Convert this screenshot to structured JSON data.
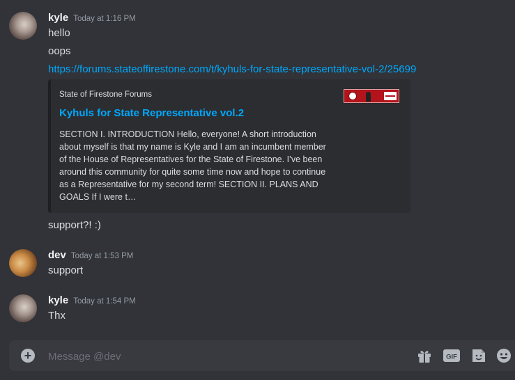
{
  "messages": [
    {
      "username": "kyle",
      "timestamp": "Today at 1:16 PM",
      "lines": [
        "hello",
        "oops",
        "https://forums.stateoffirestone.com/t/kyhuls-for-state-representative-vol-2/25699"
      ],
      "embed": {
        "provider": "State of Firestone Forums",
        "title": "Kyhuls for State Representative vol.2",
        "description": "SECTION I. INTRODUCTION Hello, everyone! A short introduction about myself is that my name is Kyle and I am an incumbent member of the House of Representatives for the State of Firestone. I’ve been around this community for quite some time now and hope to continue as a Representative for my second term! SECTION II. PLANS AND GOALS If I were t…"
      },
      "after_embed": "support?! :)"
    },
    {
      "username": "dev",
      "timestamp": "Today at 1:53 PM",
      "lines": [
        "support"
      ]
    },
    {
      "username": "kyle",
      "timestamp": "Today at 1:54 PM",
      "lines": [
        "Thx"
      ]
    }
  ],
  "composer": {
    "placeholder": "Message @dev",
    "gif_label": "GIF"
  },
  "icons": {
    "attach": "plus-circle-icon",
    "gift": "gift-icon",
    "gif": "gif-icon",
    "sticker": "sticker-icon",
    "emoji": "emoji-icon"
  },
  "colors": {
    "background": "#313338",
    "link": "#00a8fc",
    "embed_bg": "#2b2d31",
    "composer_bg": "#383a40"
  }
}
